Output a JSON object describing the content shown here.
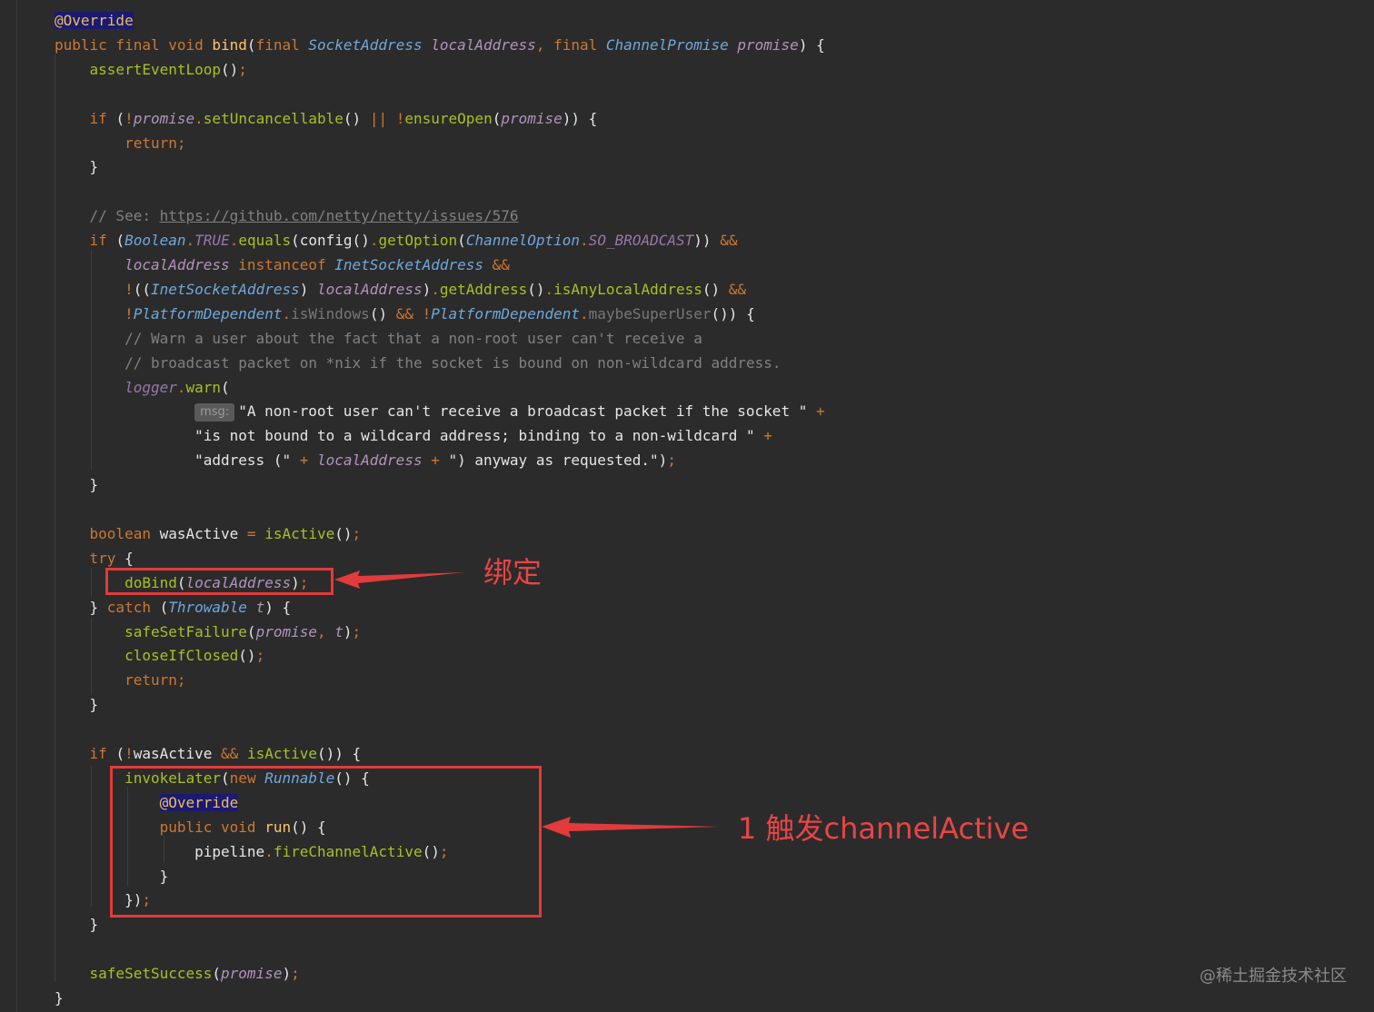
{
  "editor": {
    "lines": [
      [
        {
          "t": "@Override",
          "c": "anno"
        }
      ],
      [
        {
          "t": "public final void ",
          "c": "tok-kw"
        },
        {
          "t": "bind",
          "c": "tok-method"
        },
        {
          "t": "(",
          "c": "tok-plain"
        },
        {
          "t": "final ",
          "c": "tok-kw"
        },
        {
          "t": "SocketAddress ",
          "c": "tok-type"
        },
        {
          "t": "localAddress",
          "c": "tok-param"
        },
        {
          "t": ", ",
          "c": "tok-punct"
        },
        {
          "t": "final ",
          "c": "tok-kw"
        },
        {
          "t": "ChannelPromise ",
          "c": "tok-type"
        },
        {
          "t": "promise",
          "c": "tok-param"
        },
        {
          "t": ") {",
          "c": "tok-plain"
        }
      ],
      [
        {
          "t": "    "
        },
        {
          "t": "assertEventLoop",
          "c": "tok-green"
        },
        {
          "t": "()",
          "c": "tok-plain"
        },
        {
          "t": ";",
          "c": "tok-punct"
        }
      ],
      [],
      [
        {
          "t": "    "
        },
        {
          "t": "if ",
          "c": "tok-kw"
        },
        {
          "t": "(",
          "c": "tok-plain"
        },
        {
          "t": "!",
          "c": "tok-punct"
        },
        {
          "t": "promise",
          "c": "tok-param"
        },
        {
          "t": ".",
          "c": "tok-punct"
        },
        {
          "t": "setUncancellable",
          "c": "tok-green"
        },
        {
          "t": "() ",
          "c": "tok-plain"
        },
        {
          "t": "|| ",
          "c": "tok-punct"
        },
        {
          "t": "!",
          "c": "tok-punct"
        },
        {
          "t": "ensureOpen",
          "c": "tok-green"
        },
        {
          "t": "(",
          "c": "tok-plain"
        },
        {
          "t": "promise",
          "c": "tok-param"
        },
        {
          "t": ")) {",
          "c": "tok-plain"
        }
      ],
      [
        {
          "t": "        "
        },
        {
          "t": "return",
          "c": "tok-kw"
        },
        {
          "t": ";",
          "c": "tok-punct"
        }
      ],
      [
        {
          "t": "    }",
          "c": "tok-plain"
        }
      ],
      [],
      [
        {
          "t": "    "
        },
        {
          "t": "// See: ",
          "c": "tok-cmt"
        },
        {
          "t": "https://github.com/netty/netty/issues/576",
          "c": "tok-link"
        }
      ],
      [
        {
          "t": "    "
        },
        {
          "t": "if ",
          "c": "tok-kw"
        },
        {
          "t": "(",
          "c": "tok-plain"
        },
        {
          "t": "Boolean",
          "c": "tok-type"
        },
        {
          "t": ".",
          "c": "tok-punct"
        },
        {
          "t": "TRUE",
          "c": "tok-const"
        },
        {
          "t": ".",
          "c": "tok-punct"
        },
        {
          "t": "equals",
          "c": "tok-green"
        },
        {
          "t": "(config()",
          "c": "tok-plain"
        },
        {
          "t": ".",
          "c": "tok-punct"
        },
        {
          "t": "getOption",
          "c": "tok-green"
        },
        {
          "t": "(",
          "c": "tok-plain"
        },
        {
          "t": "ChannelOption",
          "c": "tok-type"
        },
        {
          "t": ".",
          "c": "tok-punct"
        },
        {
          "t": "SO_BROADCAST",
          "c": "tok-const"
        },
        {
          "t": ")) ",
          "c": "tok-plain"
        },
        {
          "t": "&&",
          "c": "tok-punct"
        }
      ],
      [
        {
          "t": "        "
        },
        {
          "t": "localAddress ",
          "c": "tok-param"
        },
        {
          "t": "instanceof ",
          "c": "tok-kw"
        },
        {
          "t": "InetSocketAddress ",
          "c": "tok-type"
        },
        {
          "t": "&&",
          "c": "tok-punct"
        }
      ],
      [
        {
          "t": "        "
        },
        {
          "t": "!",
          "c": "tok-punct"
        },
        {
          "t": "((",
          "c": "tok-plain"
        },
        {
          "t": "InetSocketAddress",
          "c": "tok-type"
        },
        {
          "t": ") ",
          "c": "tok-plain"
        },
        {
          "t": "localAddress",
          "c": "tok-param"
        },
        {
          "t": ")",
          "c": "tok-plain"
        },
        {
          "t": ".",
          "c": "tok-punct"
        },
        {
          "t": "getAddress",
          "c": "tok-green"
        },
        {
          "t": "()",
          "c": "tok-plain"
        },
        {
          "t": ".",
          "c": "tok-punct"
        },
        {
          "t": "isAnyLocalAddress",
          "c": "tok-green"
        },
        {
          "t": "() ",
          "c": "tok-plain"
        },
        {
          "t": "&&",
          "c": "tok-punct"
        }
      ],
      [
        {
          "t": "        "
        },
        {
          "t": "!",
          "c": "tok-punct"
        },
        {
          "t": "PlatformDependent",
          "c": "tok-type"
        },
        {
          "t": ".",
          "c": "tok-punct"
        },
        {
          "t": "isWindows",
          "c": "tok-dim"
        },
        {
          "t": "() ",
          "c": "tok-plain"
        },
        {
          "t": "&& ",
          "c": "tok-punct"
        },
        {
          "t": "!",
          "c": "tok-punct"
        },
        {
          "t": "PlatformDependent",
          "c": "tok-type"
        },
        {
          "t": ".",
          "c": "tok-punct"
        },
        {
          "t": "maybeSuperUser",
          "c": "tok-dim"
        },
        {
          "t": "()) {",
          "c": "tok-plain"
        }
      ],
      [
        {
          "t": "        "
        },
        {
          "t": "// Warn a user about the fact that a non-root user can't receive a",
          "c": "tok-cmt"
        }
      ],
      [
        {
          "t": "        "
        },
        {
          "t": "// broadcast packet on *nix if the socket is bound on non-wildcard address.",
          "c": "tok-cmt"
        }
      ],
      [
        {
          "t": "        "
        },
        {
          "t": "logger",
          "c": "tok-field"
        },
        {
          "t": ".",
          "c": "tok-punct"
        },
        {
          "t": "warn",
          "c": "tok-green"
        },
        {
          "t": "(",
          "c": "tok-plain"
        }
      ],
      [
        {
          "t": "                "
        },
        {
          "t": "msg:",
          "c": "hint"
        },
        {
          "t": "\"A non-root user can't receive a broadcast packet if the socket \" ",
          "c": "tok-str"
        },
        {
          "t": "+",
          "c": "tok-punct"
        }
      ],
      [
        {
          "t": "                "
        },
        {
          "t": "\"is not bound to a wildcard address; binding to a non-wildcard \" ",
          "c": "tok-str"
        },
        {
          "t": "+",
          "c": "tok-punct"
        }
      ],
      [
        {
          "t": "                "
        },
        {
          "t": "\"address (\" ",
          "c": "tok-str"
        },
        {
          "t": "+ ",
          "c": "tok-punct"
        },
        {
          "t": "localAddress ",
          "c": "tok-param"
        },
        {
          "t": "+ ",
          "c": "tok-punct"
        },
        {
          "t": "\") anyway as requested.\")",
          "c": "tok-str"
        },
        {
          "t": ";",
          "c": "tok-punct"
        }
      ],
      [
        {
          "t": "    }",
          "c": "tok-plain"
        }
      ],
      [],
      [
        {
          "t": "    "
        },
        {
          "t": "boolean ",
          "c": "tok-kw"
        },
        {
          "t": "wasActive ",
          "c": "tok-plain"
        },
        {
          "t": "= ",
          "c": "tok-punct"
        },
        {
          "t": "isActive",
          "c": "tok-green"
        },
        {
          "t": "()",
          "c": "tok-plain"
        },
        {
          "t": ";",
          "c": "tok-punct"
        }
      ],
      [
        {
          "t": "    "
        },
        {
          "t": "try ",
          "c": "tok-kw"
        },
        {
          "t": "{",
          "c": "tok-plain"
        }
      ],
      [
        {
          "t": "        "
        },
        {
          "t": "doBind",
          "c": "tok-green"
        },
        {
          "t": "(",
          "c": "tok-plain"
        },
        {
          "t": "localAddress",
          "c": "tok-param"
        },
        {
          "t": ")",
          "c": "tok-plain"
        },
        {
          "t": ";",
          "c": "tok-punct"
        }
      ],
      [
        {
          "t": "    } ",
          "c": "tok-plain"
        },
        {
          "t": "catch ",
          "c": "tok-kw"
        },
        {
          "t": "(",
          "c": "tok-plain"
        },
        {
          "t": "Throwable ",
          "c": "tok-type"
        },
        {
          "t": "t",
          "c": "tok-param"
        },
        {
          "t": ") {",
          "c": "tok-plain"
        }
      ],
      [
        {
          "t": "        "
        },
        {
          "t": "safeSetFailure",
          "c": "tok-green"
        },
        {
          "t": "(",
          "c": "tok-plain"
        },
        {
          "t": "promise",
          "c": "tok-param"
        },
        {
          "t": ", ",
          "c": "tok-punct"
        },
        {
          "t": "t",
          "c": "tok-param"
        },
        {
          "t": ")",
          "c": "tok-plain"
        },
        {
          "t": ";",
          "c": "tok-punct"
        }
      ],
      [
        {
          "t": "        "
        },
        {
          "t": "closeIfClosed",
          "c": "tok-green"
        },
        {
          "t": "()",
          "c": "tok-plain"
        },
        {
          "t": ";",
          "c": "tok-punct"
        }
      ],
      [
        {
          "t": "        "
        },
        {
          "t": "return",
          "c": "tok-kw"
        },
        {
          "t": ";",
          "c": "tok-punct"
        }
      ],
      [
        {
          "t": "    }",
          "c": "tok-plain"
        }
      ],
      [],
      [
        {
          "t": "    "
        },
        {
          "t": "if ",
          "c": "tok-kw"
        },
        {
          "t": "(",
          "c": "tok-plain"
        },
        {
          "t": "!",
          "c": "tok-punct"
        },
        {
          "t": "wasActive ",
          "c": "tok-plain"
        },
        {
          "t": "&& ",
          "c": "tok-punct"
        },
        {
          "t": "isActive",
          "c": "tok-green"
        },
        {
          "t": "()) {",
          "c": "tok-plain"
        }
      ],
      [
        {
          "t": "        "
        },
        {
          "t": "invokeLater",
          "c": "tok-green"
        },
        {
          "t": "(",
          "c": "tok-plain"
        },
        {
          "t": "new ",
          "c": "tok-kw"
        },
        {
          "t": "Runnable",
          "c": "tok-type"
        },
        {
          "t": "() {",
          "c": "tok-plain"
        }
      ],
      [
        {
          "t": "            "
        },
        {
          "t": "@Override",
          "c": "anno"
        }
      ],
      [
        {
          "t": "            "
        },
        {
          "t": "public void ",
          "c": "tok-kw"
        },
        {
          "t": "run",
          "c": "tok-method"
        },
        {
          "t": "() {",
          "c": "tok-plain"
        }
      ],
      [
        {
          "t": "                "
        },
        {
          "t": "pipeline",
          "c": "tok-plain"
        },
        {
          "t": ".",
          "c": "tok-punct"
        },
        {
          "t": "fireChannelActive",
          "c": "tok-green"
        },
        {
          "t": "()",
          "c": "tok-plain"
        },
        {
          "t": ";",
          "c": "tok-punct"
        }
      ],
      [
        {
          "t": "            }",
          "c": "tok-plain"
        }
      ],
      [
        {
          "t": "        })",
          "c": "tok-plain"
        },
        {
          "t": ";",
          "c": "tok-punct"
        }
      ],
      [
        {
          "t": "    }",
          "c": "tok-plain"
        }
      ],
      [],
      [
        {
          "t": "    "
        },
        {
          "t": "safeSetSuccess",
          "c": "tok-green"
        },
        {
          "t": "(",
          "c": "tok-plain"
        },
        {
          "t": "promise",
          "c": "tok-param"
        },
        {
          "t": ")",
          "c": "tok-plain"
        },
        {
          "t": ";",
          "c": "tok-punct"
        }
      ],
      [
        {
          "t": "}",
          "c": "tok-plain"
        }
      ]
    ]
  },
  "annotations": {
    "bind_label": "绑定",
    "active_label": "1 触发channelActive"
  },
  "watermark": "@稀土掘金技术社区",
  "colors": {
    "accent": "#e23b3b",
    "background": "#2b2b2b"
  }
}
